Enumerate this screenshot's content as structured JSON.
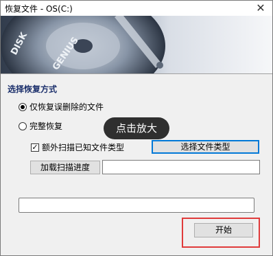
{
  "window": {
    "title": "恢复文件 - OS(C:)",
    "close_glyph": "✕"
  },
  "banner": {
    "brand_text": "DISK GENIUS"
  },
  "recovery_mode": {
    "section_title": "选择恢复方式",
    "options": [
      {
        "label": "仅恢复误删除的文件",
        "selected": true
      },
      {
        "label": "完整恢复",
        "selected": false
      }
    ]
  },
  "extra_scan": {
    "checkbox_label": "额外扫描已知文件类型",
    "checked": true,
    "select_types_label": "选择文件类型"
  },
  "load_progress": {
    "button_label": "加载扫描进度",
    "path_value": ""
  },
  "status": {
    "value": ""
  },
  "tooltip": {
    "text": "点击放大"
  },
  "actions": {
    "start_label": "开始"
  },
  "colors": {
    "section_title": "#1b2f6b",
    "highlight": "#e03a3a",
    "focus_border": "#0078d7"
  }
}
